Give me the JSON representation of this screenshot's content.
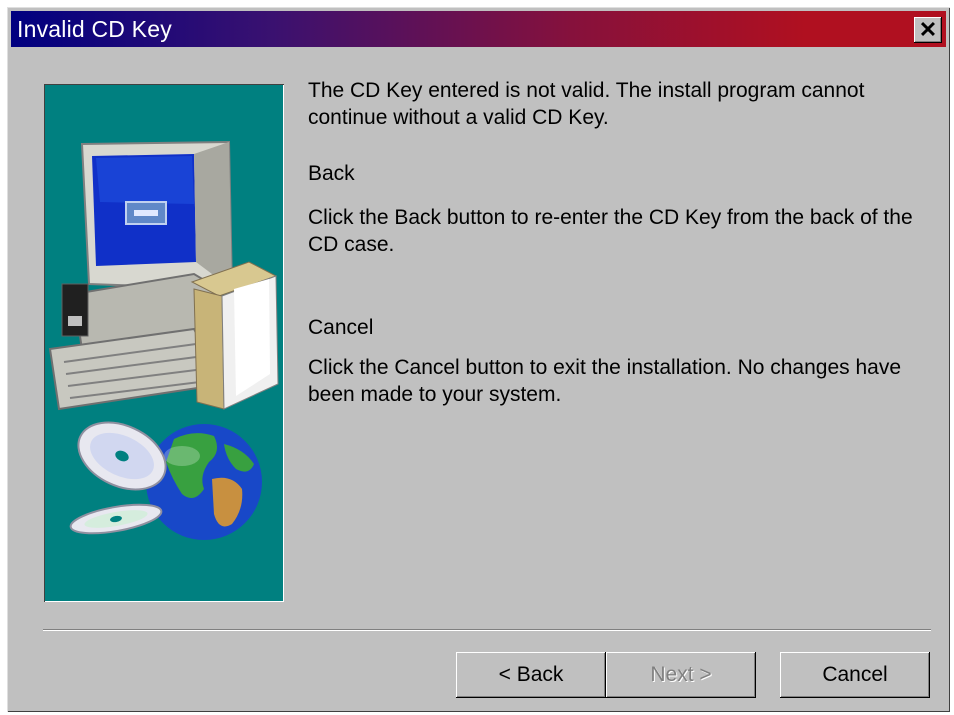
{
  "window": {
    "title": "Invalid CD Key",
    "close_glyph": "✕"
  },
  "message": {
    "intro": "The CD Key entered is not valid. The install program cannot continue without a valid CD Key.",
    "back_heading": "Back",
    "back_text": "Click the Back button to re-enter the CD Key from the back of the CD case.",
    "cancel_heading": "Cancel",
    "cancel_text": "Click the Cancel button to exit the installation. No changes have been made to your system."
  },
  "buttons": {
    "back": {
      "label": "< Back",
      "enabled": true
    },
    "next": {
      "label": "Next >",
      "enabled": false
    },
    "cancel": {
      "label": "Cancel",
      "enabled": true
    }
  },
  "icons": [
    "close-icon",
    "computer-icon",
    "cd-icon",
    "globe-icon",
    "box-icon"
  ],
  "colors": {
    "title_start": "#000080",
    "title_end": "#b01020",
    "dialog_bg": "#c0c0c0",
    "illustration_bg": "#008080"
  }
}
